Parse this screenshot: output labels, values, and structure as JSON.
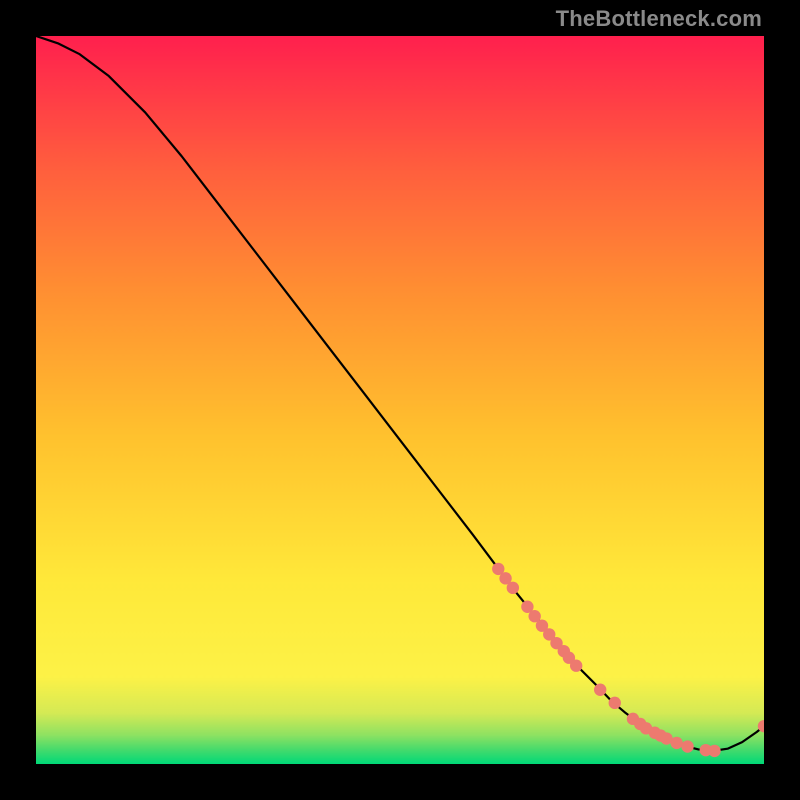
{
  "watermark": "TheBottleneck.com",
  "colors": {
    "curve": "#000000",
    "marker_fill": "#ed7a6f",
    "marker_stroke": "#8a3e36"
  },
  "chart_data": {
    "type": "line",
    "title": "",
    "xlabel": "",
    "ylabel": "",
    "xlim": [
      0,
      100
    ],
    "ylim": [
      0,
      100
    ],
    "grid": false,
    "legend": false,
    "gradient_stops": [
      {
        "t": 0.0,
        "color": "#00d978"
      },
      {
        "t": 0.02,
        "color": "#47db6c"
      },
      {
        "t": 0.04,
        "color": "#8fe262"
      },
      {
        "t": 0.07,
        "color": "#d5ea55"
      },
      {
        "t": 0.12,
        "color": "#fdf247"
      },
      {
        "t": 0.25,
        "color": "#ffe93a"
      },
      {
        "t": 0.45,
        "color": "#ffc22e"
      },
      {
        "t": 0.65,
        "color": "#ff8f32"
      },
      {
        "t": 0.82,
        "color": "#ff5e3e"
      },
      {
        "t": 1.0,
        "color": "#ff204e"
      }
    ],
    "series": [
      {
        "name": "bottleneck-curve",
        "x": [
          0,
          3,
          6,
          10,
          15,
          20,
          25,
          30,
          35,
          40,
          45,
          50,
          55,
          60,
          63,
          66,
          69,
          72,
          74,
          77,
          79,
          81,
          83,
          85,
          87,
          89,
          91,
          93,
          95,
          97,
          99,
          100
        ],
        "y": [
          100,
          99,
          97.5,
          94.5,
          89.5,
          83.5,
          77,
          70.5,
          64,
          57.5,
          51,
          44.5,
          38,
          31.5,
          27.5,
          23.5,
          19.8,
          16.3,
          13.8,
          10.8,
          8.7,
          7,
          5.5,
          4.3,
          3.3,
          2.5,
          2,
          1.8,
          2.1,
          3,
          4.4,
          5.2
        ]
      }
    ],
    "markers": {
      "name": "highlight-points",
      "x": [
        63.5,
        64.5,
        65.5,
        67.5,
        68.5,
        69.5,
        70.5,
        71.5,
        72.5,
        73.2,
        74.2,
        77.5,
        79.5,
        82,
        83,
        83.8,
        85,
        85.8,
        86.6,
        88,
        89.5,
        92,
        93.2,
        100
      ],
      "y": [
        26.8,
        25.5,
        24.2,
        21.6,
        20.3,
        19,
        17.8,
        16.6,
        15.5,
        14.6,
        13.5,
        10.2,
        8.4,
        6.2,
        5.5,
        4.9,
        4.3,
        3.9,
        3.5,
        2.9,
        2.4,
        1.9,
        1.8,
        5.2
      ]
    }
  }
}
